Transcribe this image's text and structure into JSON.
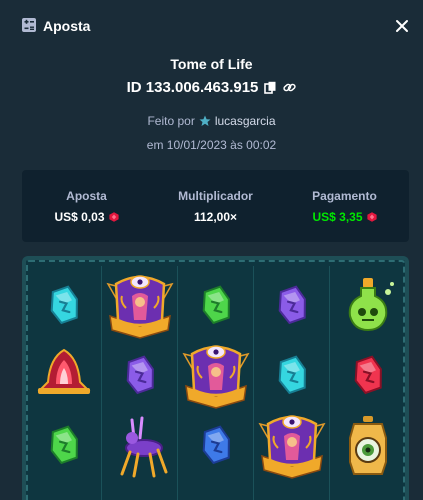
{
  "header": {
    "title": "Aposta",
    "icon": "bet-slip-icon",
    "close_icon": "close-icon"
  },
  "bet": {
    "game": "Tome of Life",
    "id": "ID 133.006.463.915",
    "made_by_label": "Feito por",
    "user": "lucasgarcia",
    "date": "em 10/01/2023 às 00:02"
  },
  "stats": {
    "bet_label": "Aposta",
    "bet_value": "US$ 0,03",
    "multiplier_label": "Multiplicador",
    "multiplier_value": "112,00×",
    "payout_label": "Pagamento",
    "payout_value": "US$ 3,35"
  },
  "colors": {
    "background": "#1a2c38",
    "panel": "#0f212e",
    "payout": "#00e701",
    "currency_gem": "#e3173e"
  },
  "board": {
    "reels": [
      [
        "cyan-rune-gem",
        "red-shrine",
        "green-rune-gem"
      ],
      [
        "tome-of-life-book",
        "purple-rune-gem",
        "purple-spider"
      ],
      [
        "green-rune-gem",
        "tome-of-life-book",
        "blue-rune-gem"
      ],
      [
        "purple-rune-gem",
        "cyan-rune-gem",
        "tome-of-life-book"
      ],
      [
        "green-potion",
        "red-rune-gem",
        "golden-eye-lantern"
      ]
    ]
  }
}
